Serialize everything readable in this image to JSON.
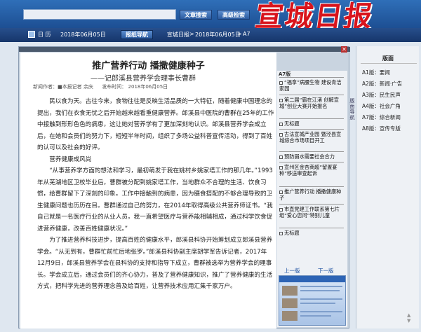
{
  "header": {
    "search_button": "文章搜索",
    "advanced_search_button": "高级检索",
    "logo_text": "宣城日报"
  },
  "nav": {
    "calendar_label": "日 历",
    "date": "2018年06月05日",
    "edition_nav_button": "报纸导航",
    "breadcrumb": [
      "宣城日报",
      "2018年06月05日",
      "A7"
    ]
  },
  "article": {
    "title": "推广营养行动  播撒健康种子",
    "subtitle": "——记郎溪县营养学会理事长曹群",
    "meta_reporter": "新闻作者：■本报记者  余庆",
    "meta_date": "发布时间：  2018年06月05日",
    "paragraphs": [
      "民以食为天。古往今来，食物往往是反映生活品质的一大特征，随着健康中国理念的提出，我们在衣食无忧之后开始越来越看重健康营养。郎溪县中医院的曹群在25年的工作中接触到形形色色的病患，这让她对营养学有了更加深刻地认识。郎溪县营养学会成立后，在她和会员们的努力下，短短半年时间，组织了多场公益科普宣传活动，得到了百姓的认可以及社会的好评。",
      "营养健康成风尚",
      "“从事营养学方面的想法和学习，最初萌发于我在姚村乡姚家塔工作的那几年。”1993年从芜湖地区卫校毕业后，曹群被分配到姚家塔工作，当地群众不合理的生活、饮食习惯，给曹群留下了深刻的印象。工作中接触到的病患，因为膳食搭配的不够合理导致的卫生健康问题也历历在目。曹群通过自己的努力，在2014年取得高级公共营养师证书。“我自己就是一名医疗行业的从业人员，我一直希望医疗与营养能相辅相成，通过科学饮食促进营养健康，改善百姓健康状况。”",
      "为了推进营养科技进步，提高百姓的健康水平，郎溪县科协开始筹划成立郎溪县营养学会。“从无到有，曹群忙前忙后地张罗。”郎溪县科协副主席胡学军告诉记者，2017年12月9日，郎溪县营养学会在县科协的支持和指导下成立，曹群被选举为营养学会的理事长。学会成立后，通过会员们的齐心协力，普及了营养健康知识，推广了营养健康的生活方式，把科学先进的营养理念普及给百姓，让营养技术应用汇集千家万户。"
    ]
  },
  "thumbnail": {
    "edition": "A7版",
    "items": [
      "“福拿”病腰生物 建设青洁家园",
      "第二届“霸在江渚 创解宣城”创业大赛开始报名",
      "无标题",
      "古法宣城产业园 暨泾县宣城综合市场项目开工",
      "预防弱水需要社会合力",
      "宣州区金杏商超“留置宴种”移送审查起诉",
      "推广营养行动 播撒健康种子",
      "市直党建工作联系第七片组“爱心您问”特别儿童",
      "无标题"
    ],
    "prev_label": "上一版",
    "next_label": "下一版"
  },
  "side_tab": "版面导航",
  "right_panel": {
    "title": "版面",
    "items": [
      "A1版：要闻",
      "A2版：新闻·广告",
      "A3版：民生民声",
      "A4版：社会广角",
      "A7版：综合新闻",
      "A8版：宣传专版"
    ]
  },
  "colors": {
    "accent_blue": "#1d4f93",
    "logo_red": "#d8141c"
  }
}
